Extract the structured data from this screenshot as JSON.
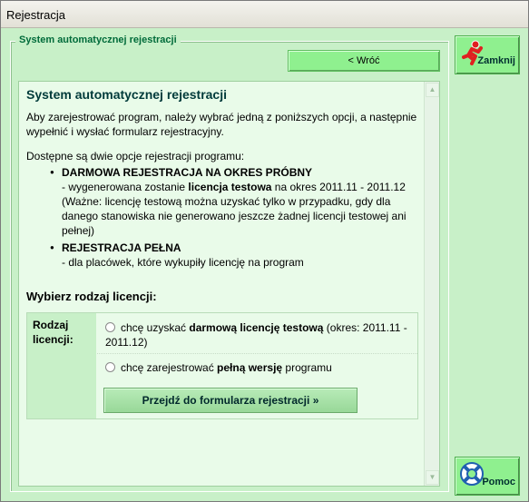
{
  "window": {
    "title": "Rejestracja"
  },
  "group": {
    "label": "System automatycznej rejestracji"
  },
  "nav": {
    "back_label": "< Wróć"
  },
  "side": {
    "close_label": "Zamknij",
    "help_label": "Pomoc"
  },
  "content": {
    "heading": "System automatycznej rejestracji",
    "intro": "Aby zarejestrować program, należy wybrać jedną z poniższych opcji, a następnie wypełnić i wysłać formularz rejestracyjny.",
    "options_intro": "Dostępne są dwie opcje rejestracji programu:",
    "option_trial": {
      "title": "DARMOWA REJESTRACJA NA OKRES PRÓBNY",
      "line_prefix": "- wygenerowana zostanie ",
      "line_bold": "licencja testowa",
      "line_suffix": " na okres 2011.11 - 2011.12",
      "note": "(Ważne: licencję testową można uzyskać tylko w przypadku, gdy dla danego stanowiska nie generowano jeszcze żadnej licencji testowej ani pełnej)"
    },
    "option_full": {
      "title": "REJESTRACJA PEŁNA",
      "line": "- dla placówek, które wykupiły licencję na program"
    },
    "choose_heading": "Wybierz rodzaj licencji:",
    "license": {
      "label": "Rodzaj licencji:",
      "radio1_prefix": "chcę uzyskać ",
      "radio1_bold": "darmową licencję testową",
      "radio1_suffix": " (okres: 2011.11 - 2011.12)",
      "radio2_prefix": "chcę zarejestrować ",
      "radio2_bold": "pełną wersję",
      "radio2_suffix": " programu",
      "submit_label": "Przejdź do formularza rejestracji »"
    }
  }
}
